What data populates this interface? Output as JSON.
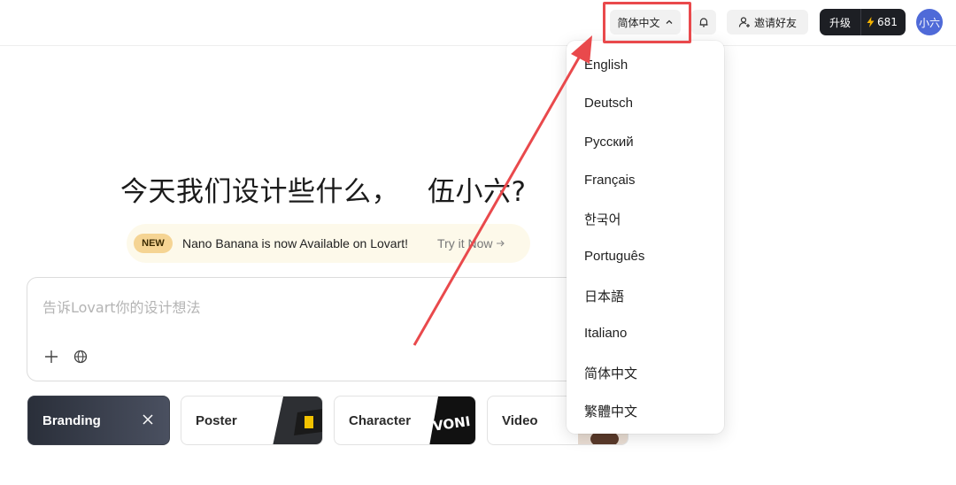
{
  "header": {
    "language_button": "简体中文",
    "invite_label": "邀请好友",
    "upgrade_label": "升级",
    "credits": "681",
    "avatar_text": "小六"
  },
  "main": {
    "headline": "今天我们设计些什么，",
    "username": "伍小六?",
    "promo": {
      "badge": "NEW",
      "message": "Nano Banana is now Available on Lovart!",
      "cta": "Try it Now"
    },
    "prompt": {
      "placeholder": "告诉Lovart你的设计想法"
    },
    "cards": [
      {
        "label": "Branding"
      },
      {
        "label": "Poster"
      },
      {
        "label": "Character"
      },
      {
        "label": "Video"
      }
    ]
  },
  "language_menu": {
    "items": [
      "English",
      "Deutsch",
      "Русский",
      "Français",
      "한국어",
      "Português",
      "日本語",
      "Italiano",
      "简体中文",
      "繁體中文"
    ]
  },
  "colors": {
    "annotation": "#e9494c",
    "avatar": "#4f6ad8",
    "upgrade_bg": "#1d1f24",
    "credit_bolt": "#f5b301",
    "promo_bg": "#fdf9ea",
    "badge_bg": "#f5d493"
  },
  "icons": [
    "chevron-up-icon",
    "bell-icon",
    "user-plus-icon",
    "lightning-icon",
    "plus-icon",
    "globe-icon",
    "close-icon",
    "arrow-right-icon"
  ]
}
